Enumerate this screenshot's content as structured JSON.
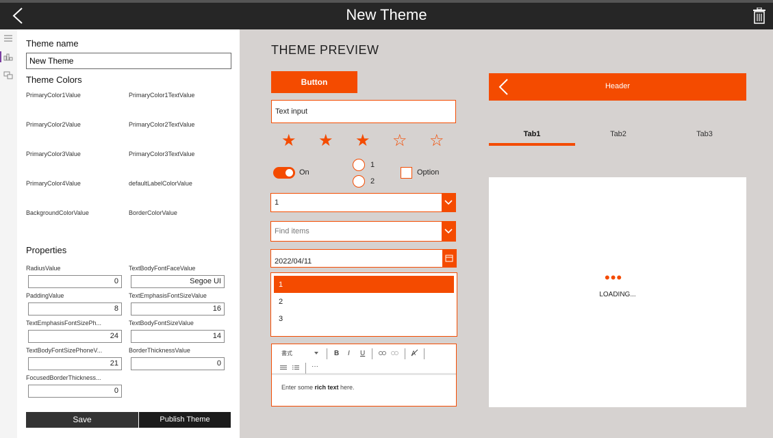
{
  "app": {
    "title": "New Theme",
    "icons": {
      "back": "chevron-left-icon",
      "delete": "trash-icon"
    }
  },
  "rail": {
    "icons": [
      "hamburger-menu-icon",
      "theme-palette-icon",
      "preview-screens-icon"
    ]
  },
  "left": {
    "theme_name_label": "Theme name",
    "theme_name_value": "New Theme",
    "theme_colors_label": "Theme Colors",
    "colors": [
      "PrimaryColor1Value",
      "PrimaryColor1TextValue",
      "PrimaryColor2Value",
      "PrimaryColor2TextValue",
      "PrimaryColor3Value",
      "PrimaryColor3TextValue",
      "PrimaryColor4Value",
      "defaultLabelColorValue",
      "BackgroundColorValue",
      "BorderColorValue"
    ],
    "properties_label": "Properties",
    "properties": [
      {
        "label": "RadiusValue",
        "value": "0"
      },
      {
        "label": "TextBodyFontFaceValue",
        "value": "Segoe UI"
      },
      {
        "label": "PaddingValue",
        "value": "8"
      },
      {
        "label": "TextEmphasisFontSizeValue",
        "value": "16"
      },
      {
        "label": "TextEmphasisFontSizePh...",
        "value": "24"
      },
      {
        "label": "TextBodyFontSizeValue",
        "value": "14"
      },
      {
        "label": "TextBodyFontSizePhoneV...",
        "value": "21"
      },
      {
        "label": "BorderThicknessValue",
        "value": "0"
      },
      {
        "label": "FocusedBorderThickness...",
        "value": "0"
      }
    ],
    "save_label": "Save",
    "publish_label": "Publish Theme"
  },
  "preview": {
    "title": "THEME PREVIEW",
    "button_label": "Button",
    "text_input_value": "Text input",
    "rating": {
      "value": 3,
      "max": 5
    },
    "toggle": {
      "on": true,
      "label": "On"
    },
    "radio_options": [
      "1",
      "2"
    ],
    "checkbox_label": "Option",
    "dropdown_value": "1",
    "combobox_placeholder": "Find items",
    "date_value": "2022/04/11",
    "list_items": [
      "1",
      "2",
      "3"
    ],
    "list_selected_index": 0,
    "rte": {
      "format_label": "書式",
      "bold": "B",
      "italic": "I",
      "underline": "U",
      "more": "···",
      "body_prefix": "Enter some ",
      "body_bold": "rich text",
      "body_suffix": " here."
    },
    "phone": {
      "header_title": "Header",
      "tabs": [
        "Tab1",
        "Tab2",
        "Tab3"
      ],
      "active_tab": 0,
      "loading_text": "LOADING...",
      "loading_dots": "•••"
    }
  },
  "colors": {
    "accent": "#f44b00",
    "topbar": "#262626",
    "canvas": "#d6d2d0"
  }
}
